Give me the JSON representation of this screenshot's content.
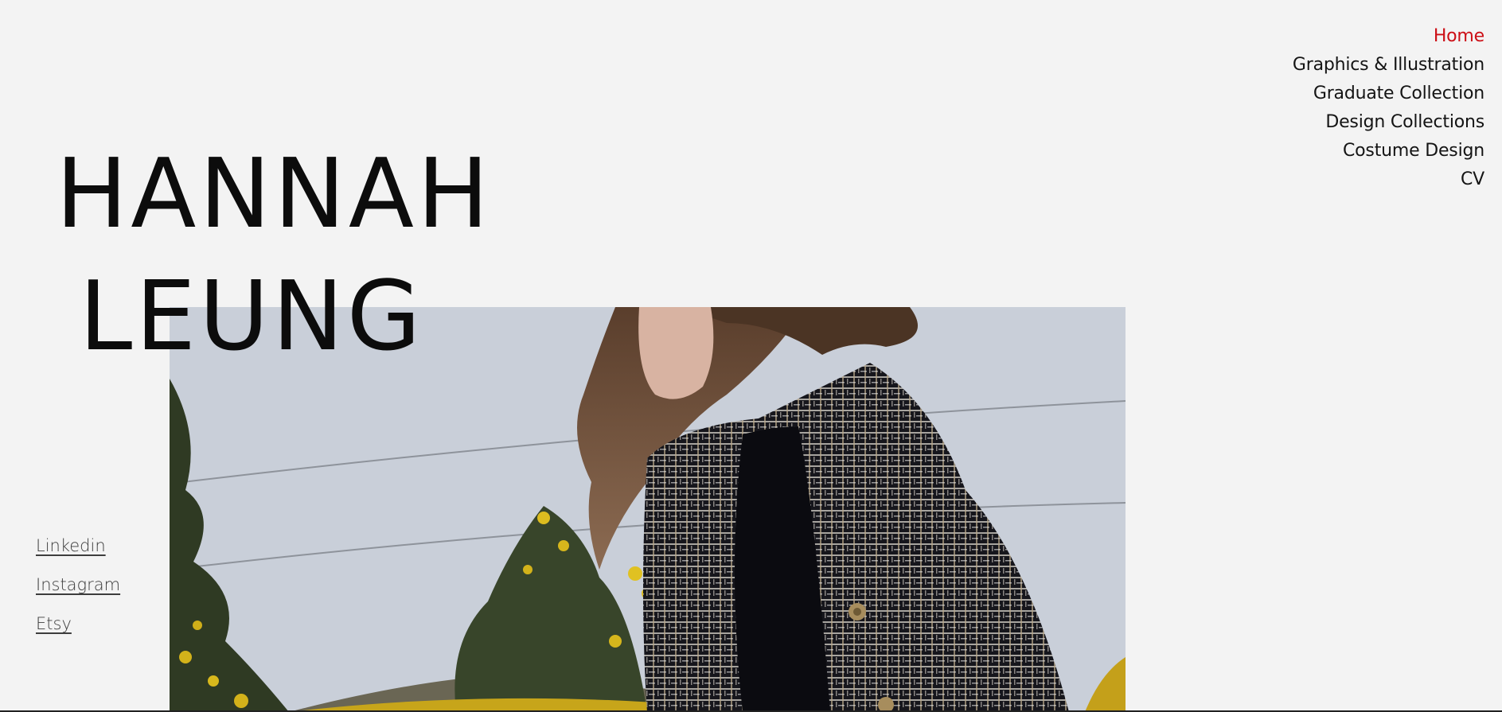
{
  "site": {
    "name_line1": "HANNAH",
    "name_line2": "LEUNG"
  },
  "nav": {
    "items": [
      {
        "label": "Home",
        "active": true
      },
      {
        "label": "Graphics & Illustration",
        "active": false
      },
      {
        "label": "Graduate Collection",
        "active": false
      },
      {
        "label": "Design Collections",
        "active": false
      },
      {
        "label": "Costume Design",
        "active": false
      },
      {
        "label": "CV",
        "active": false
      }
    ]
  },
  "social": {
    "links": [
      {
        "label": "Linkedin"
      },
      {
        "label": "Instagram"
      },
      {
        "label": "Etsy"
      }
    ]
  },
  "colors": {
    "background": "#f3f3f3",
    "accent": "#cc0f16",
    "text": "#141414"
  }
}
